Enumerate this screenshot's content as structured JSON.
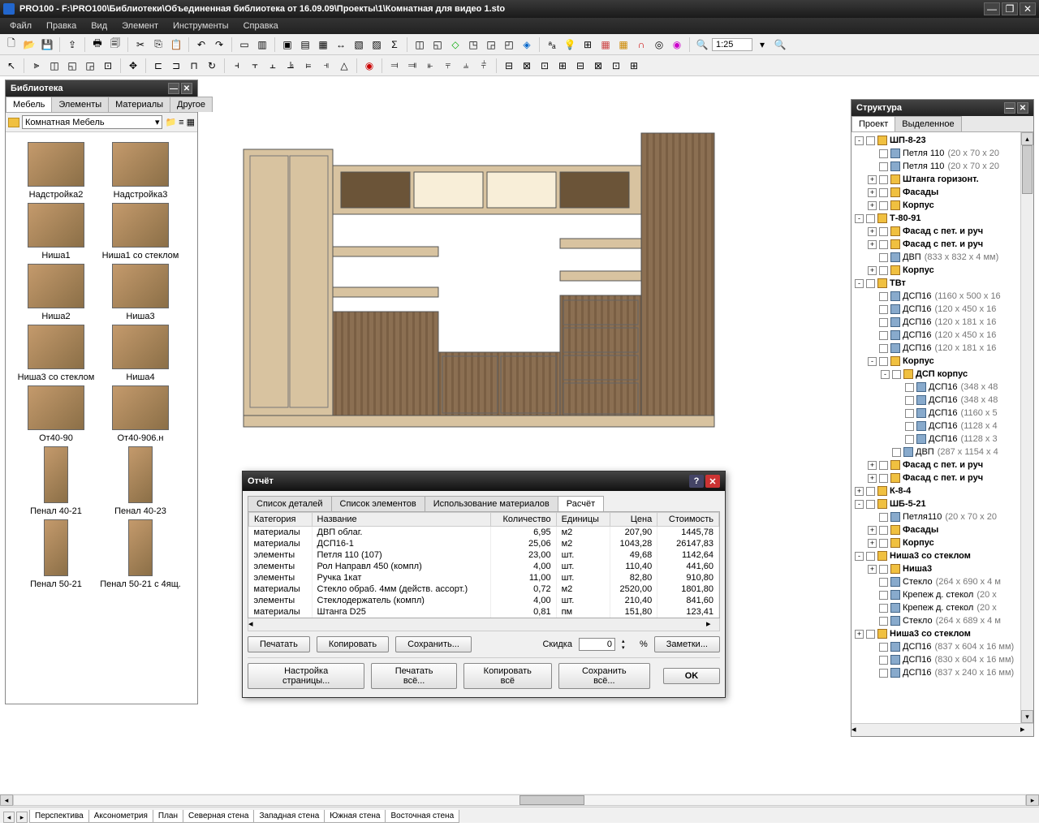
{
  "titlebar": {
    "title": "PRO100 - F:\\PRO100\\Библиотеки\\Объединенная библиотека от 16.09.09\\Проекты\\1\\Комнатная для видео 1.sto"
  },
  "menu": [
    "Файл",
    "Правка",
    "Вид",
    "Элемент",
    "Инструменты",
    "Справка"
  ],
  "toolbar": {
    "zoom": "1:25"
  },
  "library": {
    "title": "Библиотека",
    "tabs": [
      "Мебель",
      "Элементы",
      "Материалы",
      "Другое"
    ],
    "active_tab": 0,
    "folder": "Комнатная Мебель",
    "items": [
      {
        "label": "Надстройка2"
      },
      {
        "label": "Надстройка3"
      },
      {
        "label": "Ниша1"
      },
      {
        "label": "Ниша1 со стеклом"
      },
      {
        "label": "Ниша2"
      },
      {
        "label": "Ниша3"
      },
      {
        "label": "Ниша3 со стеклом"
      },
      {
        "label": "Ниша4"
      },
      {
        "label": "От40-90"
      },
      {
        "label": "От40-906.н"
      },
      {
        "label": "Пенал 40-21",
        "tall": true
      },
      {
        "label": "Пенал 40-23",
        "tall": true
      },
      {
        "label": "Пенал 50-21",
        "tall": true
      },
      {
        "label": "Пенал 50-21 с 4ящ.",
        "tall": true
      }
    ]
  },
  "structure": {
    "title": "Структура",
    "tabs": [
      "Проект",
      "Выделенное"
    ],
    "active_tab": 0,
    "rows": [
      {
        "ind": 0,
        "exp": "-",
        "ic": "grp",
        "bold": true,
        "label": "ШП-8-23"
      },
      {
        "ind": 1,
        "exp": "",
        "ic": "itm",
        "label": "Петля 110",
        "dims": "(20 x 70 x 20"
      },
      {
        "ind": 1,
        "exp": "",
        "ic": "itm",
        "label": "Петля 110",
        "dims": "(20 x 70 x 20"
      },
      {
        "ind": 1,
        "exp": "+",
        "ic": "grp",
        "bold": true,
        "label": "Штанга горизонт."
      },
      {
        "ind": 1,
        "exp": "+",
        "ic": "grp",
        "bold": true,
        "label": "Фасады"
      },
      {
        "ind": 1,
        "exp": "+",
        "ic": "grp",
        "bold": true,
        "label": "Корпус"
      },
      {
        "ind": 0,
        "exp": "-",
        "ic": "grp",
        "bold": true,
        "label": "Т-80-91"
      },
      {
        "ind": 1,
        "exp": "+",
        "ic": "grp",
        "bold": true,
        "label": "Фасад с пет. и руч"
      },
      {
        "ind": 1,
        "exp": "+",
        "ic": "grp",
        "bold": true,
        "label": "Фасад с пет. и руч"
      },
      {
        "ind": 1,
        "exp": "",
        "ic": "itm",
        "label": "ДВП",
        "dims": "(833 x 832 x 4 мм)"
      },
      {
        "ind": 1,
        "exp": "+",
        "ic": "grp",
        "bold": true,
        "label": "Корпус"
      },
      {
        "ind": 0,
        "exp": "-",
        "ic": "grp",
        "bold": true,
        "label": "ТВт"
      },
      {
        "ind": 1,
        "exp": "",
        "ic": "itm",
        "label": "ДСП16",
        "dims": "(1160 x 500 x 16"
      },
      {
        "ind": 1,
        "exp": "",
        "ic": "itm",
        "label": "ДСП16",
        "dims": "(120 x 450 x 16"
      },
      {
        "ind": 1,
        "exp": "",
        "ic": "itm",
        "label": "ДСП16",
        "dims": "(120 x 181 x 16"
      },
      {
        "ind": 1,
        "exp": "",
        "ic": "itm",
        "label": "ДСП16",
        "dims": "(120 x 450 x 16"
      },
      {
        "ind": 1,
        "exp": "",
        "ic": "itm",
        "label": "ДСП16",
        "dims": "(120 x 181 x 16"
      },
      {
        "ind": 1,
        "exp": "-",
        "ic": "grp",
        "bold": true,
        "label": "Корпус"
      },
      {
        "ind": 2,
        "exp": "-",
        "ic": "grp",
        "bold": true,
        "label": "ДСП корпус"
      },
      {
        "ind": 3,
        "exp": "",
        "ic": "itm",
        "label": "ДСП16",
        "dims": "(348 x 48"
      },
      {
        "ind": 3,
        "exp": "",
        "ic": "itm",
        "label": "ДСП16",
        "dims": "(348 x 48"
      },
      {
        "ind": 3,
        "exp": "",
        "ic": "itm",
        "label": "ДСП16",
        "dims": "(1160 x 5"
      },
      {
        "ind": 3,
        "exp": "",
        "ic": "itm",
        "label": "ДСП16",
        "dims": "(1128 x 4"
      },
      {
        "ind": 3,
        "exp": "",
        "ic": "itm",
        "label": "ДСП16",
        "dims": "(1128 x 3"
      },
      {
        "ind": 2,
        "exp": "",
        "ic": "itm",
        "label": "ДВП",
        "dims": "(287 x 1154 x 4"
      },
      {
        "ind": 1,
        "exp": "+",
        "ic": "grp",
        "bold": true,
        "label": "Фасад с пет. и руч"
      },
      {
        "ind": 1,
        "exp": "+",
        "ic": "grp",
        "bold": true,
        "label": "Фасад с пет. и руч"
      },
      {
        "ind": 0,
        "exp": "+",
        "ic": "grp",
        "bold": true,
        "label": "К-8-4"
      },
      {
        "ind": 0,
        "exp": "-",
        "ic": "grp",
        "bold": true,
        "label": "ШБ-5-21"
      },
      {
        "ind": 1,
        "exp": "",
        "ic": "itm",
        "label": "Петля110",
        "dims": "(20 x 70 x 20"
      },
      {
        "ind": 1,
        "exp": "+",
        "ic": "grp",
        "bold": true,
        "label": "Фасады"
      },
      {
        "ind": 1,
        "exp": "+",
        "ic": "grp",
        "bold": true,
        "label": "Корпус"
      },
      {
        "ind": 0,
        "exp": "-",
        "ic": "grp",
        "bold": true,
        "label": "Ниша3 со стеклом"
      },
      {
        "ind": 1,
        "exp": "+",
        "ic": "grp",
        "bold": true,
        "label": "Ниша3"
      },
      {
        "ind": 1,
        "exp": "",
        "ic": "itm",
        "label": "Стекло",
        "dims": "(264 x 690 x 4 м"
      },
      {
        "ind": 1,
        "exp": "",
        "ic": "itm",
        "label": "Крепеж д. стекол",
        "dims": "(20 x"
      },
      {
        "ind": 1,
        "exp": "",
        "ic": "itm",
        "label": "Крепеж д. стекол",
        "dims": "(20 x"
      },
      {
        "ind": 1,
        "exp": "",
        "ic": "itm",
        "label": "Стекло",
        "dims": "(264 x 689 x 4 м"
      },
      {
        "ind": 0,
        "exp": "+",
        "ic": "grp",
        "bold": true,
        "label": "Ниша3 со стеклом"
      },
      {
        "ind": 1,
        "exp": "",
        "ic": "itm",
        "label": "ДСП16",
        "dims": "(837 x 604 x 16 мм)"
      },
      {
        "ind": 1,
        "exp": "",
        "ic": "itm",
        "label": "ДСП16",
        "dims": "(830 x 604 x 16 мм)"
      },
      {
        "ind": 1,
        "exp": "",
        "ic": "itm",
        "label": "ДСП16",
        "dims": "(837 x 240 x 16 мм)"
      }
    ]
  },
  "report": {
    "title": "Отчёт",
    "tabs": [
      "Список деталей",
      "Список элементов",
      "Использование материалов",
      "Расчёт"
    ],
    "active_tab": 3,
    "headers": [
      "Категория",
      "Название",
      "Количество",
      "Единицы",
      "Цена",
      "Стоимость"
    ],
    "rows": [
      [
        "материалы",
        "ДВП облаг.",
        "6,95",
        "м2",
        "207,90",
        "1445,78"
      ],
      [
        "материалы",
        "ДСП16-1",
        "25,06",
        "м2",
        "1043,28",
        "26147,83"
      ],
      [
        "элементы",
        "Петля 110 (107)",
        "23,00",
        "шт.",
        "49,68",
        "1142,64"
      ],
      [
        "элементы",
        "Рол Направл 450 (компл)",
        "4,00",
        "шт.",
        "110,40",
        "441,60"
      ],
      [
        "элементы",
        "Ручка 1кат",
        "11,00",
        "шт.",
        "82,80",
        "910,80"
      ],
      [
        "материалы",
        "Стекло обраб. 4мм (действ. ассорт.)",
        "0,72",
        "м2",
        "2520,00",
        "1801,80"
      ],
      [
        "элементы",
        "Стеклодержатель (компл)",
        "4,00",
        "шт.",
        "210,40",
        "841,60"
      ],
      [
        "материалы",
        "Штанга D25",
        "0,81",
        "пм",
        "151,80",
        "123,41"
      ]
    ],
    "buttons_row1": {
      "print": "Печатать",
      "copy": "Копировать",
      "save": "Сохранить..."
    },
    "discount_label": "Скидка",
    "discount_value": "0",
    "percent": "%",
    "notes": "Заметки...",
    "buttons_row2": {
      "page": "Настройка страницы...",
      "printall": "Печатать всё...",
      "copyall": "Копировать всё",
      "saveall": "Сохранить всё...",
      "ok": "OK"
    }
  },
  "view_tabs": [
    "Перспектива",
    "Аксонометрия",
    "План",
    "Северная стена",
    "Западная стена",
    "Южная стена",
    "Восточная стена"
  ]
}
